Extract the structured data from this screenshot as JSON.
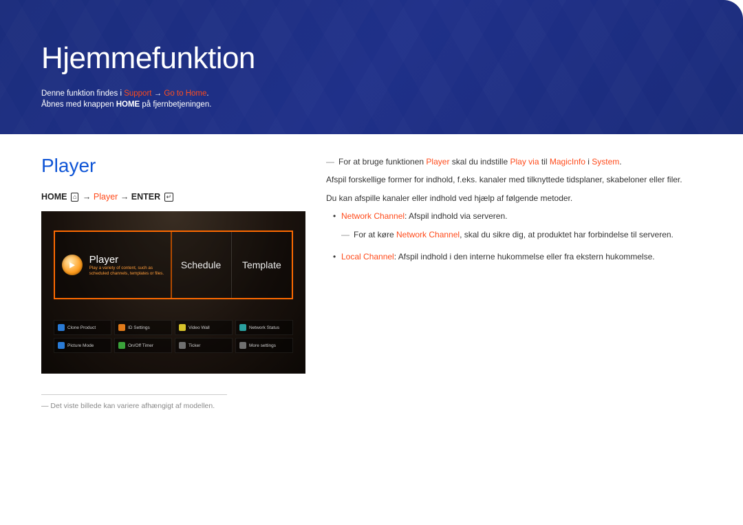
{
  "header": {
    "title": "Hjemmefunktion",
    "line1_pre": "Denne funktion findes i ",
    "line1_support": "Support",
    "line1_arrow": " → ",
    "line1_goto": "Go to Home",
    "line1_post": ".",
    "line2_pre": "Åbnes med knappen ",
    "line2_home": "HOME",
    "line2_post": " på fjernbetjeningen."
  },
  "section": {
    "title": "Player",
    "path_home": "HOME",
    "path_player": "Player",
    "path_enter": "ENTER",
    "arrow": " → "
  },
  "tv": {
    "tiles": {
      "player": "Player",
      "player_desc": "Play a variety of content, such as scheduled channels, templates or files.",
      "schedule": "Schedule",
      "template": "Template"
    },
    "grid": [
      "Clone Product",
      "ID Settings",
      "Video Wall",
      "Network Status",
      "Picture Mode",
      "On/Off Timer",
      "Ticker",
      "More settings"
    ]
  },
  "footnote": "Det viste billede kan variere afhængigt af modellen.",
  "right": {
    "note1_pre": "For at bruge funktionen ",
    "note1_player": "Player",
    "note1_mid": " skal du indstille ",
    "note1_playvia": "Play via",
    "note1_til": " til ",
    "note1_magic": "MagicInfo",
    "note1_i": " i ",
    "note1_system": "System",
    "note1_end": ".",
    "p1": "Afspil forskellige former for indhold, f.eks. kanaler med tilknyttede tidsplaner, skabeloner eller filer.",
    "p2": "Du kan afspille kanaler eller indhold ved hjælp af følgende metoder.",
    "b1_label": "Network Channel",
    "b1_text": ": Afspil indhold via serveren.",
    "b1_sub_pre": "For at køre ",
    "b1_sub_nc": "Network Channel",
    "b1_sub_post": ", skal du sikre dig, at produktet har forbindelse til serveren.",
    "b2_label": "Local Channel",
    "b2_text": ": Afspil indhold i den interne hukommelse eller fra ekstern hukommelse."
  }
}
